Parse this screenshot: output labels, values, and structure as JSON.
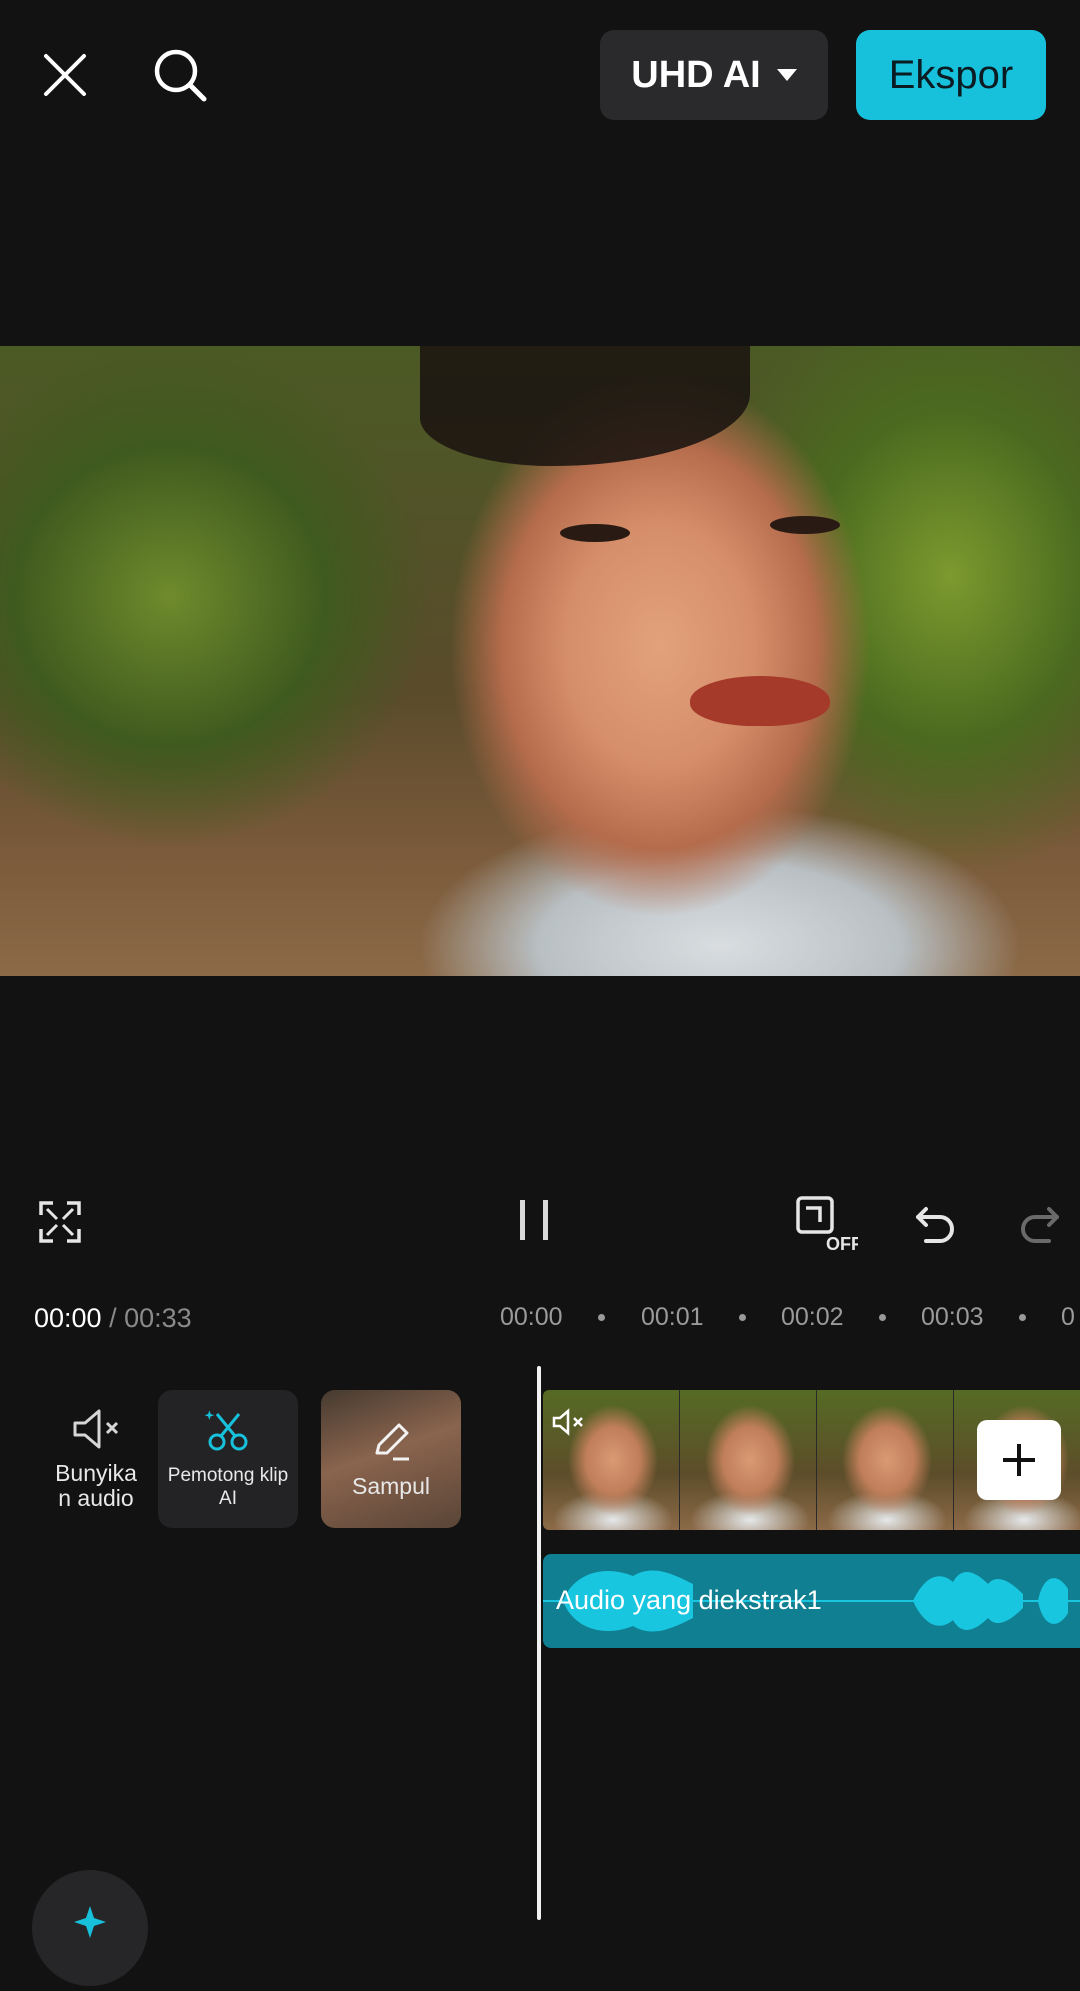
{
  "top_bar": {
    "close_icon": "close-icon",
    "search_icon": "search-icon",
    "quality_label": "UHD AI",
    "export_label": "Ekspor",
    "accent": "#17c1dc"
  },
  "preview": {
    "description_icon": "video-preview"
  },
  "controls": {
    "fullscreen_icon": "fullscreen-icon",
    "pause_icon": "pause-icon",
    "keyframe_icon": "keyframe-off-icon",
    "keyframe_off_label": "OFF",
    "undo_icon": "undo-icon",
    "redo_icon": "redo-icon"
  },
  "time": {
    "current": "00:00",
    "separator": "/",
    "total": "00:33"
  },
  "ruler": {
    "ticks": [
      "00:00",
      "00:01",
      "00:02",
      "00:03",
      "0"
    ]
  },
  "tools": {
    "mute_label": "Bunyikan audio",
    "mute_line1": "Bunyika",
    "mute_line2": "n audio",
    "ai_cut_line1": "Pemotong klip",
    "ai_cut_line2": "AI",
    "cover_label": "Sampul"
  },
  "timeline": {
    "audio_track_label": "Audio yang diekstrak1",
    "add_icon": "plus-icon"
  }
}
